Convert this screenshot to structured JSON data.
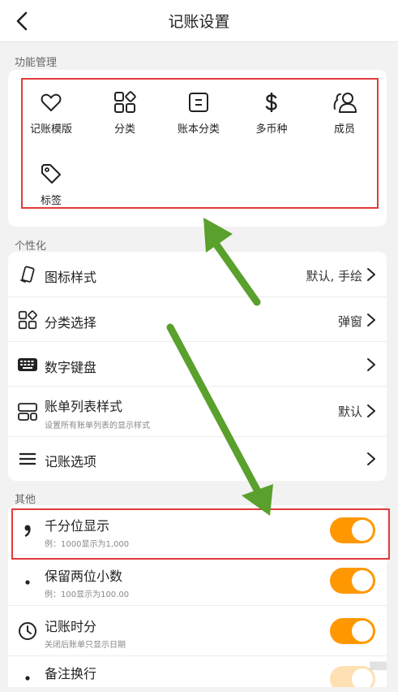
{
  "header": {
    "title": "记账设置"
  },
  "sections": {
    "features": "功能管理",
    "personal": "个性化",
    "other": "其他"
  },
  "features": [
    {
      "label": "记账模版",
      "icon": "heart-icon"
    },
    {
      "label": "分类",
      "icon": "category-grid-icon"
    },
    {
      "label": "账本分类",
      "icon": "ledger-icon"
    },
    {
      "label": "多币种",
      "icon": "dollar-icon"
    },
    {
      "label": "成员",
      "icon": "members-icon"
    },
    {
      "label": "标签",
      "icon": "tag-icon"
    }
  ],
  "personal": [
    {
      "title": "图标样式",
      "value": "默认, 手绘",
      "icon": "phone-icon"
    },
    {
      "title": "分类选择",
      "value": "弹窗",
      "icon": "category-grid-icon"
    },
    {
      "title": "数字键盘",
      "value": "",
      "icon": "keyboard-icon"
    },
    {
      "title": "账单列表样式",
      "subtitle": "设置所有账单列表的显示样式",
      "value": "默认",
      "icon": "list-style-icon"
    },
    {
      "title": "记账选项",
      "value": "",
      "icon": "menu-icon"
    }
  ],
  "other": [
    {
      "title": "千分位显示",
      "subtitle": "例：1000显示为1,000",
      "enabled": true,
      "icon": "comma-icon"
    },
    {
      "title": "保留两位小数",
      "subtitle": "例：100显示为100.00",
      "enabled": true,
      "icon": "dot-icon"
    },
    {
      "title": "记账时分",
      "subtitle": "关闭后账单只显示日期",
      "enabled": true,
      "icon": "clock-icon"
    },
    {
      "title": "备注换行",
      "enabled": true,
      "icon": "dot-icon"
    }
  ],
  "colors": {
    "accent": "#ff9800",
    "highlight": "#e23b3b",
    "arrow": "#5aa02c"
  }
}
